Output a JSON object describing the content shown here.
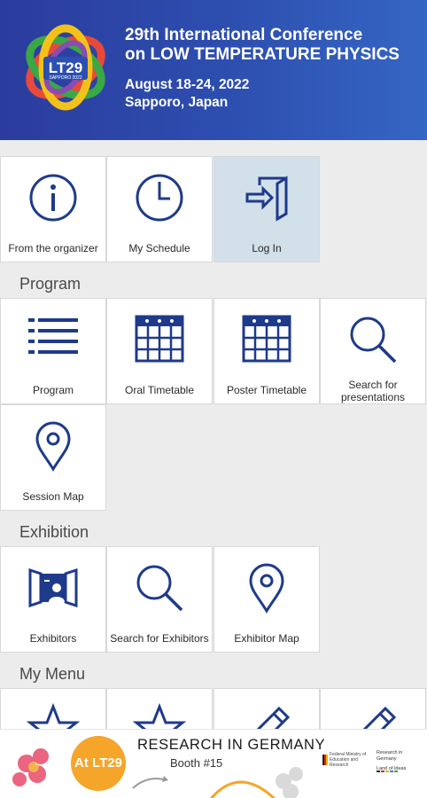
{
  "header": {
    "logo_text": "LT29",
    "logo_subtext": "SAPPORO 2022",
    "title_line1": "29th International Conference",
    "title_line2": "on LOW TEMPERATURE PHYSICS",
    "dates": "August 18-24, 2022",
    "location": "Sapporo, Japan"
  },
  "top_tiles": [
    {
      "label": "From the organizer",
      "icon": "info-icon"
    },
    {
      "label": "My Schedule",
      "icon": "clock-icon"
    },
    {
      "label": "Log In",
      "icon": "login-icon",
      "active": true
    }
  ],
  "sections": {
    "program": {
      "title": "Program",
      "tiles": [
        {
          "label": "Program",
          "icon": "list-icon"
        },
        {
          "label": "Oral Timetable",
          "icon": "calendar-icon"
        },
        {
          "label": "Poster Timetable",
          "icon": "calendar-icon"
        },
        {
          "label_line1": "Search for",
          "label_line2": "presentations",
          "icon": "search-icon"
        },
        {
          "label": "Session Map",
          "icon": "map-pin-icon"
        }
      ]
    },
    "exhibition": {
      "title": "Exhibition",
      "tiles": [
        {
          "label": "Exhibitors",
          "icon": "exhibitor-icon"
        },
        {
          "label": "Search for Exhibitors",
          "icon": "search-icon"
        },
        {
          "label": "Exhibitor Map",
          "icon": "map-pin-icon"
        }
      ]
    },
    "my_menu": {
      "title": "My Menu",
      "tiles": [
        {
          "icon": "star-icon"
        },
        {
          "icon": "star-icon"
        },
        {
          "icon": "pencil-icon"
        },
        {
          "icon": "pencil-icon"
        }
      ]
    }
  },
  "banner": {
    "badge": "At LT29",
    "title": "RESEARCH IN GERMANY",
    "booth": "Booth #15",
    "ministry_text": "Federal Ministry of Education and Research",
    "right_line1": "Research in",
    "right_line2": "Germany",
    "right_line3": "Land of Ideas"
  },
  "colors": {
    "header_bg": "#2d4fb0",
    "icon_blue": "#1e3a8a",
    "active_tile": "#d2e0ea",
    "badge_orange": "#f4a52a"
  }
}
